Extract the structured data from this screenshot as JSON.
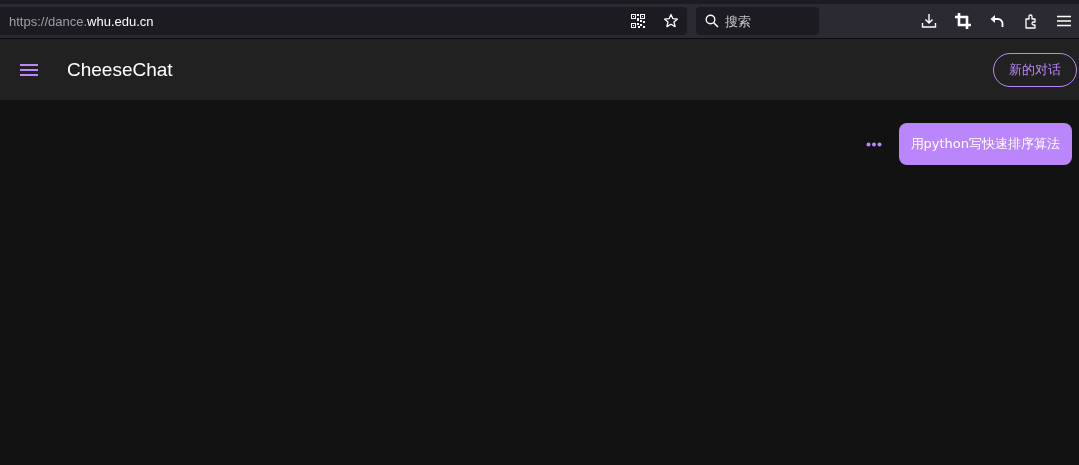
{
  "browser": {
    "url_scheme_host": "https://dance.",
    "url_domain": "whu.edu.cn",
    "search": {
      "placeholder": "搜索"
    }
  },
  "app": {
    "title": "CheeseChat",
    "new_chat_button": "新的对话"
  },
  "messages": [
    {
      "kind": "user",
      "text": "用python写快速排序算法"
    }
  ]
}
